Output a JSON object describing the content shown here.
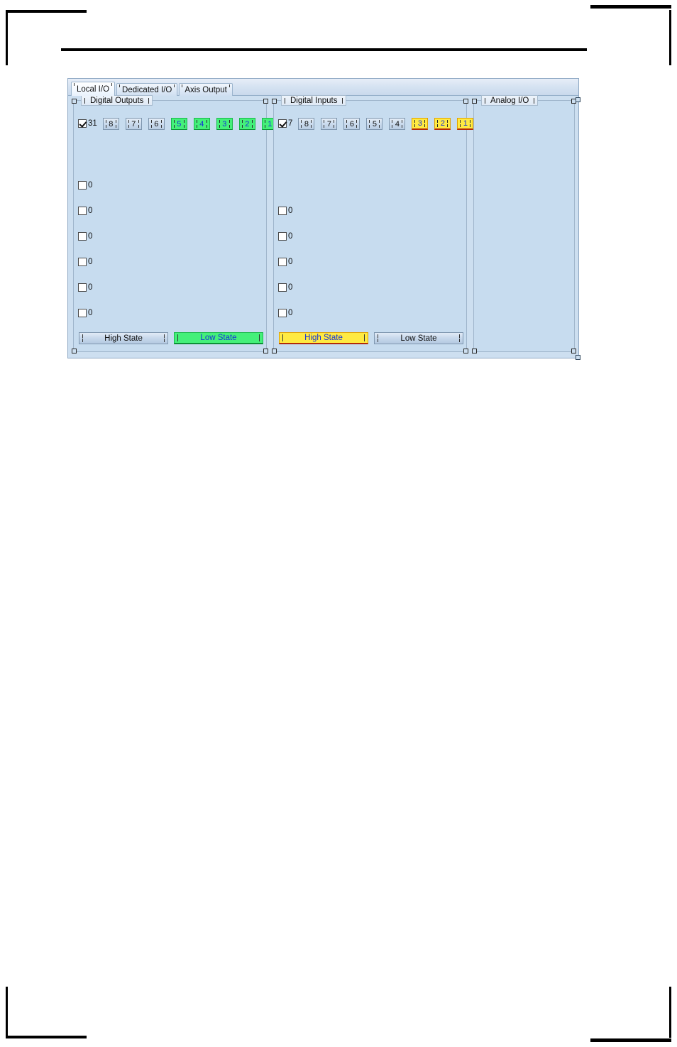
{
  "window": {
    "tabs": [
      {
        "label": "Local I/O",
        "active": true
      },
      {
        "label": "Dedicated I/O",
        "active": false
      },
      {
        "label": "Axis Output",
        "active": false
      }
    ]
  },
  "digital_outputs": {
    "caption": "Digital Outputs",
    "master_checkbox": {
      "checked": true,
      "label": "31"
    },
    "buttons": [
      {
        "label": "8",
        "state": "off"
      },
      {
        "label": "7",
        "state": "off"
      },
      {
        "label": "6",
        "state": "off"
      },
      {
        "label": "5",
        "state": "on"
      },
      {
        "label": "4",
        "state": "on"
      },
      {
        "label": "3",
        "state": "on"
      },
      {
        "label": "2",
        "state": "on"
      },
      {
        "label": "1",
        "state": "on"
      }
    ],
    "checkboxes": [
      {
        "checked": false,
        "label": "0"
      },
      {
        "checked": false,
        "label": "0"
      },
      {
        "checked": false,
        "label": "0"
      },
      {
        "checked": false,
        "label": "0"
      },
      {
        "checked": false,
        "label": "0"
      },
      {
        "checked": false,
        "label": "0"
      }
    ],
    "state_buttons": [
      {
        "label": "High State",
        "state": "off"
      },
      {
        "label": "Low State",
        "state": "on"
      }
    ]
  },
  "digital_inputs": {
    "caption": "Digital Inputs",
    "master_checkbox": {
      "checked": true,
      "label": "7"
    },
    "buttons": [
      {
        "label": "8",
        "state": "off"
      },
      {
        "label": "7",
        "state": "off"
      },
      {
        "label": "6",
        "state": "off"
      },
      {
        "label": "5",
        "state": "off"
      },
      {
        "label": "4",
        "state": "off"
      },
      {
        "label": "3",
        "state": "on"
      },
      {
        "label": "2",
        "state": "on"
      },
      {
        "label": "1",
        "state": "on"
      }
    ],
    "checkboxes": [
      {
        "checked": false,
        "label": "0"
      },
      {
        "checked": false,
        "label": "0"
      },
      {
        "checked": false,
        "label": "0"
      },
      {
        "checked": false,
        "label": "0"
      },
      {
        "checked": false,
        "label": "0"
      }
    ],
    "state_buttons": [
      {
        "label": "High State",
        "state": "on"
      },
      {
        "label": "Low State",
        "state": "off"
      }
    ]
  },
  "analog_io": {
    "caption": "Analog I/O",
    "items": []
  },
  "colors": {
    "panel_background": "#cddff0",
    "group_background": "#c7dcef",
    "on_output": "#44f07a",
    "on_input": "#ffea42",
    "value_text": "#1633d8"
  }
}
